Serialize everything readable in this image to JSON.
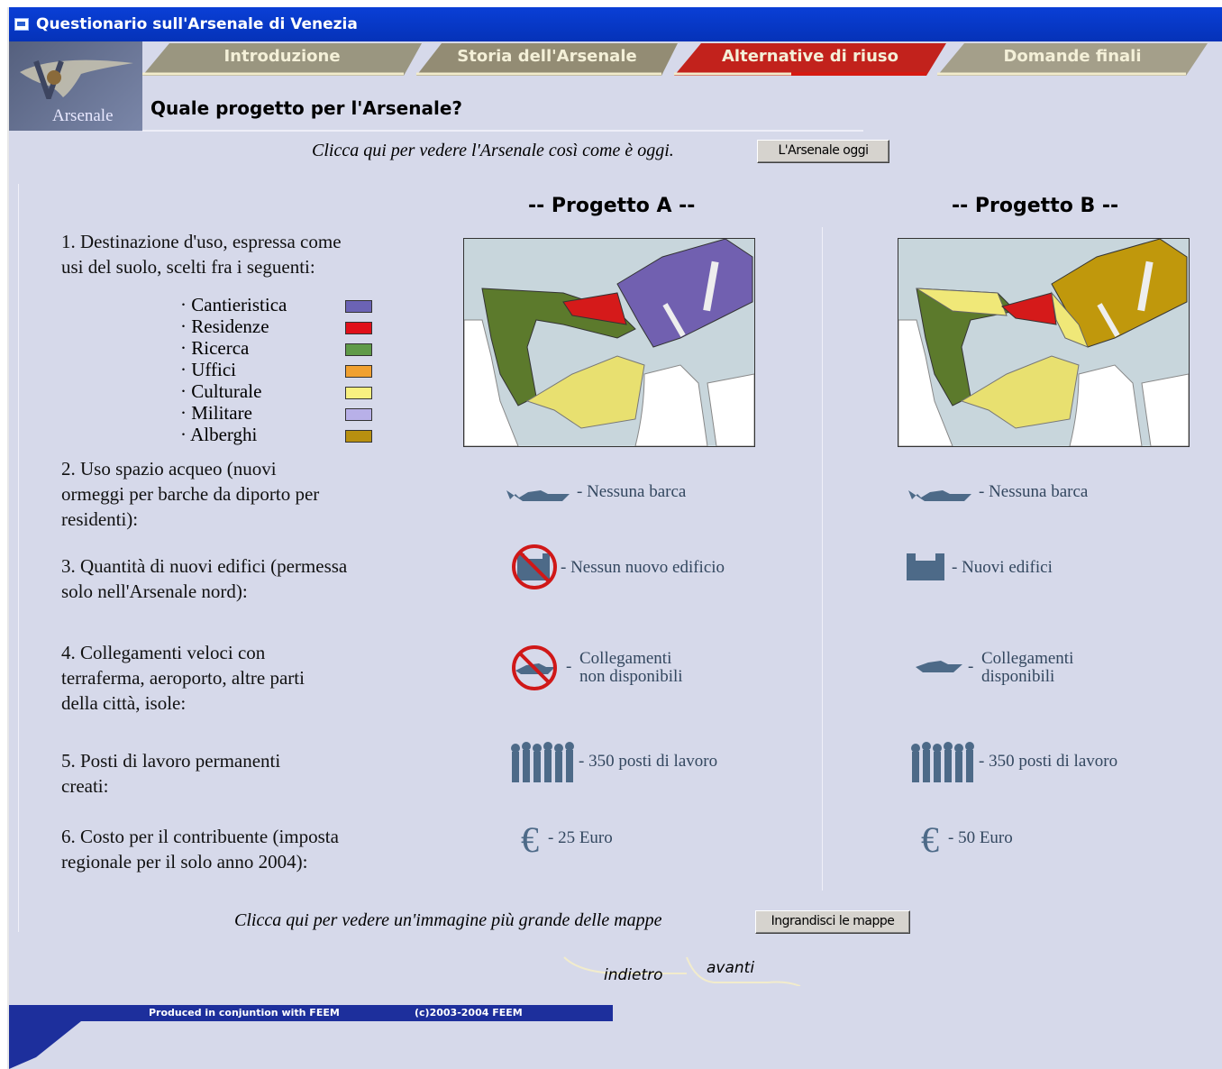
{
  "window": {
    "title": "Questionario sull'Arsenale di Venezia"
  },
  "logo": {
    "text": "Arsenale"
  },
  "tabs": [
    {
      "label": "Introduzione"
    },
    {
      "label": "Storia dell'Arsenale"
    },
    {
      "label": "Alternative di riuso",
      "active": true
    },
    {
      "label": "Domande finali"
    }
  ],
  "page": {
    "title": "Quale progetto per l'Arsenale?"
  },
  "top_note": {
    "text": "Clicca qui per vedere l'Arsenale così come è oggi.",
    "button": "L'Arsenale oggi"
  },
  "projects": {
    "a": "-- Progetto A --",
    "b": "-- Progetto B --"
  },
  "questions": {
    "q1": [
      "1. Destinazione d'uso, espressa come",
      "usi del suolo, scelti fra i seguenti:"
    ],
    "q2": [
      "2. Uso spazio acqueo (nuovi",
      "ormeggi per barche da diporto per",
      "residenti):"
    ],
    "q3": [
      "3. Quantità di nuovi edifici (permessa",
      "solo nell'Arsenale nord):"
    ],
    "q4": [
      "4. Collegamenti veloci con",
      "terraferma, aeroporto, altre parti",
      "della città, isole:"
    ],
    "q5": [
      "5. Posti di lavoro permanenti",
      "creati:"
    ],
    "q6": [
      "6. Costo per il contribuente (imposta",
      "regionale per il solo anno 2004):"
    ]
  },
  "legend": [
    {
      "label": "· Cantieristica",
      "color": "#6b63b5"
    },
    {
      "label": "· Residenze",
      "color": "#e0101a"
    },
    {
      "label": "· Ricerca",
      "color": "#5f9a48"
    },
    {
      "label": "· Uffici",
      "color": "#f0a030"
    },
    {
      "label": "· Culturale",
      "color": "#f8f080"
    },
    {
      "label": "· Militare",
      "color": "#b8b0e8"
    },
    {
      "label": "· Alberghi",
      "color": "#b89010"
    }
  ],
  "answers": {
    "a": {
      "q2": "- Nessuna barca",
      "q3": "- Nessun nuovo edificio",
      "q4": [
        "Collegamenti",
        "non disponibili"
      ],
      "q5": "- 350 posti di lavoro",
      "q6": "- 25 Euro"
    },
    "b": {
      "q2": "- Nessuna barca",
      "q3": "- Nuovi edifici",
      "q4": [
        "Collegamenti",
        "disponibili"
      ],
      "q5": "- 350 posti di lavoro",
      "q6": "- 50 Euro"
    }
  },
  "bottom_note": {
    "text": "Clicca qui per vedere un'immagine più grande delle mappe",
    "button": "Ingrandisci le mappe"
  },
  "nav": {
    "back": "indietro",
    "next": "avanti"
  },
  "footer": {
    "left": "Produced in conjuntion with FEEM",
    "right": "(c)2003-2004 FEEM"
  }
}
